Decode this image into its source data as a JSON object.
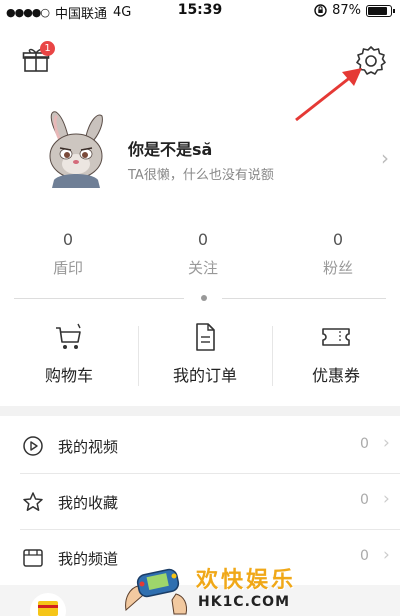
{
  "status_bar": {
    "signal": "●●●●○",
    "carrier": "中国联通",
    "network": "4G",
    "time": "15:39",
    "battery_text": "87%",
    "battery_level": 0.87
  },
  "header": {
    "gift_badge": "1"
  },
  "profile": {
    "username": "你是不是să",
    "bio": "TA很懒，什么也没有说额"
  },
  "stats": [
    {
      "value": "0",
      "label": "盾印"
    },
    {
      "value": "0",
      "label": "关注"
    },
    {
      "value": "0",
      "label": "粉丝"
    }
  ],
  "shortcuts": [
    {
      "label": "购物车",
      "icon": "shopping-cart-icon"
    },
    {
      "label": "我的订单",
      "icon": "order-document-icon"
    },
    {
      "label": "优惠券",
      "icon": "coupon-ticket-icon"
    }
  ],
  "menu": [
    {
      "label": "我的视频",
      "count": "0",
      "icon": "play-circle-icon"
    },
    {
      "label": "我的收藏",
      "count": "0",
      "icon": "star-icon"
    },
    {
      "label": "我的频道",
      "count": "0",
      "icon": "channel-tv-icon"
    }
  ],
  "chevron": "›",
  "watermark": {
    "title": "欢快娱乐",
    "domain": "HK1C.COM"
  },
  "colors": {
    "badge": "#e94545",
    "annotation_arrow": "#e53935",
    "watermark_gold": "#f0a818"
  }
}
